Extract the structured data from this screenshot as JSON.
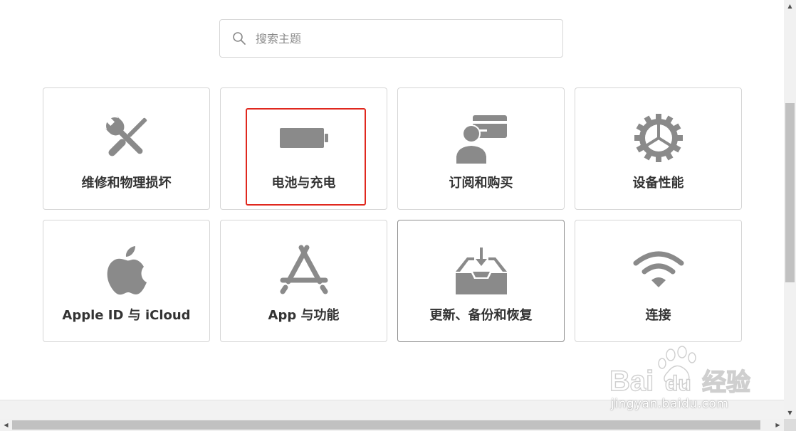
{
  "search": {
    "placeholder": "搜索主题"
  },
  "tiles": [
    {
      "label": "维修和物理损坏",
      "icon": "tools-icon"
    },
    {
      "label": "电池与充电",
      "icon": "battery-icon"
    },
    {
      "label": "订阅和购买",
      "icon": "subscription-icon"
    },
    {
      "label": "设备性能",
      "icon": "gear-icon"
    },
    {
      "label": "Apple ID 与 iCloud",
      "icon": "apple-icon"
    },
    {
      "label": "App 与功能",
      "icon": "app-store-icon"
    },
    {
      "label": "更新、备份和恢复",
      "icon": "backup-tray-icon"
    },
    {
      "label": "连接",
      "icon": "wifi-icon"
    }
  ],
  "highlight": {
    "target": "电池与充电",
    "color": "#e0281e"
  },
  "colors": {
    "icon": "#8a8a8a",
    "label": "#333333",
    "border": "#d6d6d6"
  },
  "watermark": {
    "brand": "Bai 经验",
    "url": "jingyan.baidu.com"
  }
}
